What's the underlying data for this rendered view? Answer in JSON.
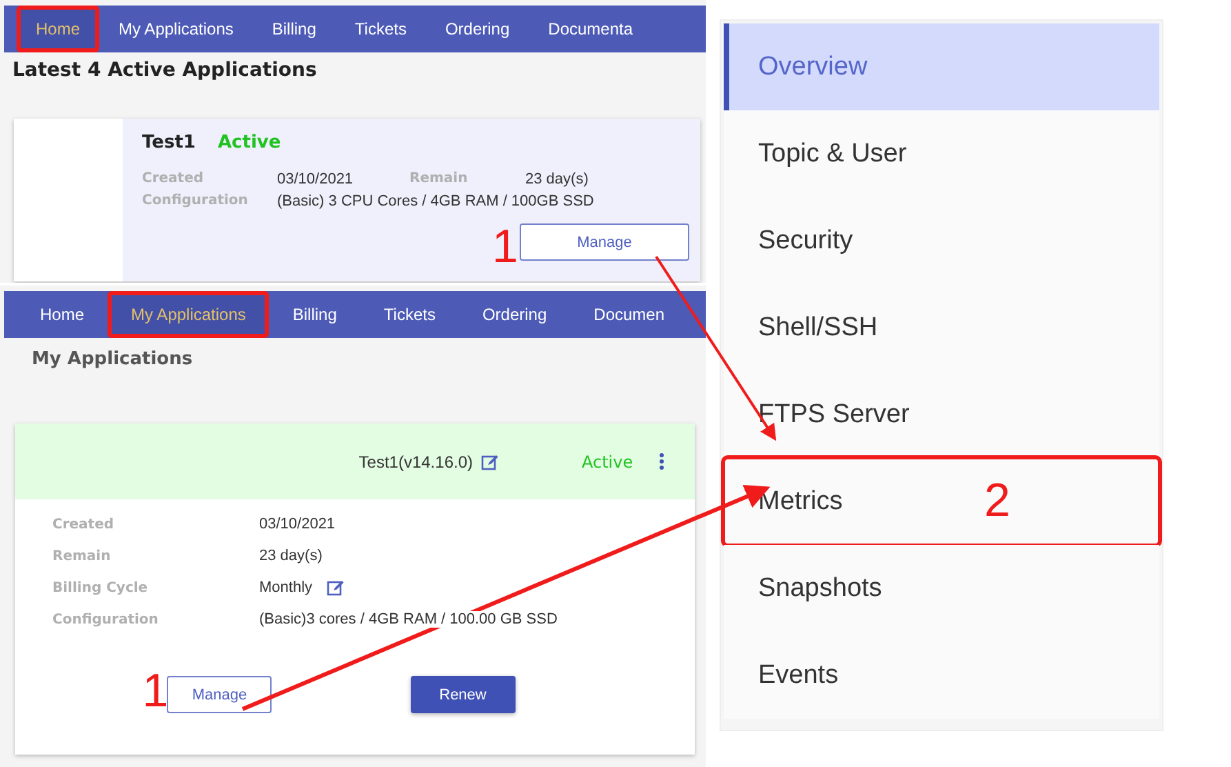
{
  "panels": [
    {
      "kind": "home",
      "nav": [
        {
          "label": "Home",
          "selected": true,
          "annotated": true
        },
        {
          "label": "My Applications",
          "selected": false,
          "annotated": false
        },
        {
          "label": "Billing",
          "selected": false,
          "annotated": false
        },
        {
          "label": "Tickets",
          "selected": false,
          "annotated": false
        },
        {
          "label": "Ordering",
          "selected": false,
          "annotated": false
        },
        {
          "label": "Documenta",
          "selected": false,
          "annotated": false
        }
      ],
      "heading": "Latest 4 Active Applications",
      "card": {
        "title": "Test1",
        "status": "Active",
        "fields": [
          {
            "label": "Created",
            "value": "03/10/2021"
          },
          {
            "label": "Remain",
            "value": "23 day(s)"
          },
          {
            "label": "Configuration",
            "value": "(Basic) 3 CPU Cores / 4GB RAM / 100GB SSD"
          }
        ],
        "buttons": [
          {
            "label": "Manage",
            "kind": "outline",
            "callout": "1"
          }
        ]
      }
    },
    {
      "kind": "apps",
      "nav": [
        {
          "label": "Home",
          "selected": false,
          "annotated": false
        },
        {
          "label": "My Applications",
          "selected": true,
          "annotated": true
        },
        {
          "label": "Billing",
          "selected": false,
          "annotated": false
        },
        {
          "label": "Tickets",
          "selected": false,
          "annotated": false
        },
        {
          "label": "Ordering",
          "selected": false,
          "annotated": false
        },
        {
          "label": "Documen",
          "selected": false,
          "annotated": false
        }
      ],
      "heading": "My Applications",
      "card": {
        "title": "Test1(v14.16.0)",
        "status": "Active",
        "fields": [
          {
            "label": "Created",
            "value": "03/10/2021",
            "editable": false
          },
          {
            "label": "Remain",
            "value": "23 day(s)",
            "editable": false
          },
          {
            "label": "Billing Cycle",
            "value": "Monthly",
            "editable": true
          },
          {
            "label": "Configuration",
            "value": "(Basic)3 cores / 4GB RAM / 100.00 GB SSD",
            "editable": false
          }
        ],
        "buttons": [
          {
            "label": "Manage",
            "kind": "outline",
            "callout": "1"
          },
          {
            "label": "Renew",
            "kind": "primary"
          }
        ]
      }
    }
  ],
  "sidebar": {
    "items": [
      {
        "label": "Overview",
        "selected": true,
        "annotated": false
      },
      {
        "label": "Topic & User",
        "selected": false,
        "annotated": false
      },
      {
        "label": "Security",
        "selected": false,
        "annotated": false
      },
      {
        "label": "Shell/SSH",
        "selected": false,
        "annotated": false
      },
      {
        "label": "FTPS Server",
        "selected": false,
        "annotated": false
      },
      {
        "label": "Metrics",
        "selected": false,
        "annotated": true,
        "callout": "2"
      },
      {
        "label": "Snapshots",
        "selected": false,
        "annotated": false
      },
      {
        "label": "Events",
        "selected": false,
        "annotated": false
      }
    ]
  }
}
